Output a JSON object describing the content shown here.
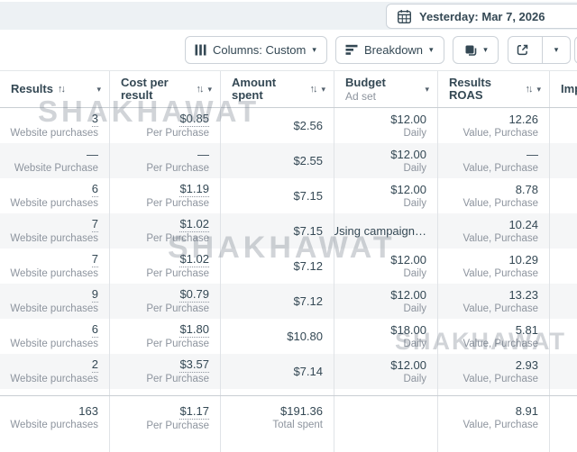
{
  "topbar": {
    "date_button_label": "Yesterday: Mar 7, 2026"
  },
  "toolbar": {
    "columns_label": "Columns: Custom",
    "breakdown_label": "Breakdown"
  },
  "icons": {
    "sort": "↑↓",
    "caret": "▾"
  },
  "watermark": {
    "text": "SHAKHAWAT"
  },
  "colors": {
    "row_alt": "#f5f6f7",
    "divider": "#e0e3e7",
    "text_primary": "#344854",
    "text_secondary": "#8d949e",
    "topstrip_bg": "#edf1f4"
  },
  "table": {
    "columns": [
      {
        "label": "Results"
      },
      {
        "label": "Cost per result"
      },
      {
        "label": "Amount spent"
      },
      {
        "label": "Budget",
        "sublabel": "Ad set"
      },
      {
        "label": "Results ROAS"
      },
      {
        "label": "Imp"
      }
    ],
    "rows": [
      {
        "results": "3",
        "results_dotted": true,
        "results_sub": "Website purchases",
        "cost": "$0.85",
        "cost_dotted": true,
        "cost_sub": "Per Purchase",
        "spent": "$2.56",
        "budget": "$12.00",
        "budget_sub": "Daily",
        "roas": "12.26",
        "roas_sub": "Value, Purchase"
      },
      {
        "results": "—",
        "results_dotted": false,
        "results_sub": "Website Purchase",
        "cost": "—",
        "cost_dotted": false,
        "cost_sub": "Per Purchase",
        "spent": "$2.55",
        "budget": "$12.00",
        "budget_sub": "Daily",
        "roas": "—",
        "roas_sub": "Value, Purchase"
      },
      {
        "results": "6",
        "results_dotted": true,
        "results_sub": "Website purchases",
        "cost": "$1.19",
        "cost_dotted": true,
        "cost_sub": "Per Purchase",
        "spent": "$7.15",
        "budget": "$12.00",
        "budget_sub": "Daily",
        "roas": "8.78",
        "roas_sub": "Value, Purchase"
      },
      {
        "results": "7",
        "results_dotted": true,
        "results_sub": "Website purchases",
        "cost": "$1.02",
        "cost_dotted": true,
        "cost_sub": "Per Purchase",
        "spent": "$7.15",
        "budget": "Using campaign…",
        "budget_sub": "",
        "roas": "10.24",
        "roas_sub": "Value, Purchase"
      },
      {
        "results": "7",
        "results_dotted": true,
        "results_sub": "Website purchases",
        "cost": "$1.02",
        "cost_dotted": true,
        "cost_sub": "Per Purchase",
        "spent": "$7.12",
        "budget": "$12.00",
        "budget_sub": "Daily",
        "roas": "10.29",
        "roas_sub": "Value, Purchase"
      },
      {
        "results": "9",
        "results_dotted": true,
        "results_sub": "Website purchases",
        "cost": "$0.79",
        "cost_dotted": true,
        "cost_sub": "Per Purchase",
        "spent": "$7.12",
        "budget": "$12.00",
        "budget_sub": "Daily",
        "roas": "13.23",
        "roas_sub": "Value, Purchase"
      },
      {
        "results": "6",
        "results_dotted": true,
        "results_sub": "Website purchases",
        "cost": "$1.80",
        "cost_dotted": true,
        "cost_sub": "Per Purchase",
        "spent": "$10.80",
        "budget": "$18.00",
        "budget_sub": "Daily",
        "roas": "5.81",
        "roas_sub": "Value, Purchase"
      },
      {
        "results": "2",
        "results_dotted": true,
        "results_sub": "Website purchases",
        "cost": "$3.57",
        "cost_dotted": true,
        "cost_sub": "Per Purchase",
        "spent": "$7.14",
        "budget": "$12.00",
        "budget_sub": "Daily",
        "roas": "2.93",
        "roas_sub": "Value, Purchase"
      }
    ],
    "footer": {
      "results": "163",
      "results_dotted": false,
      "results_sub": "Website purchases",
      "cost": "$1.17",
      "cost_dotted": true,
      "cost_sub": "Per Purchase",
      "spent": "$191.36",
      "spent_sub": "Total spent",
      "budget": "",
      "budget_sub": "",
      "roas": "8.91",
      "roas_sub": "Value, Purchase"
    }
  }
}
